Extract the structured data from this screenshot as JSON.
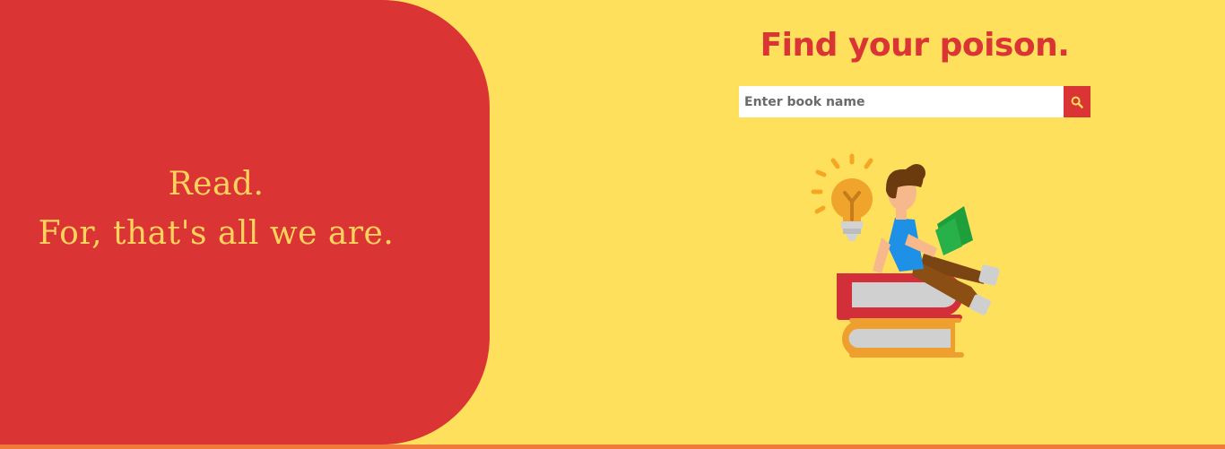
{
  "hero": {
    "line1": "Read.",
    "line2": "For, that's all we are."
  },
  "search": {
    "heading": "Find your poison.",
    "placeholder": "Enter book name",
    "icon": "search-icon"
  },
  "colors": {
    "background": "#ffe05c",
    "accent_red": "#da3434",
    "tagline_yellow": "#ffd35c",
    "bottom_strip": "#f07a3a"
  },
  "illustration": {
    "icon": "reading-on-books-illustration"
  }
}
